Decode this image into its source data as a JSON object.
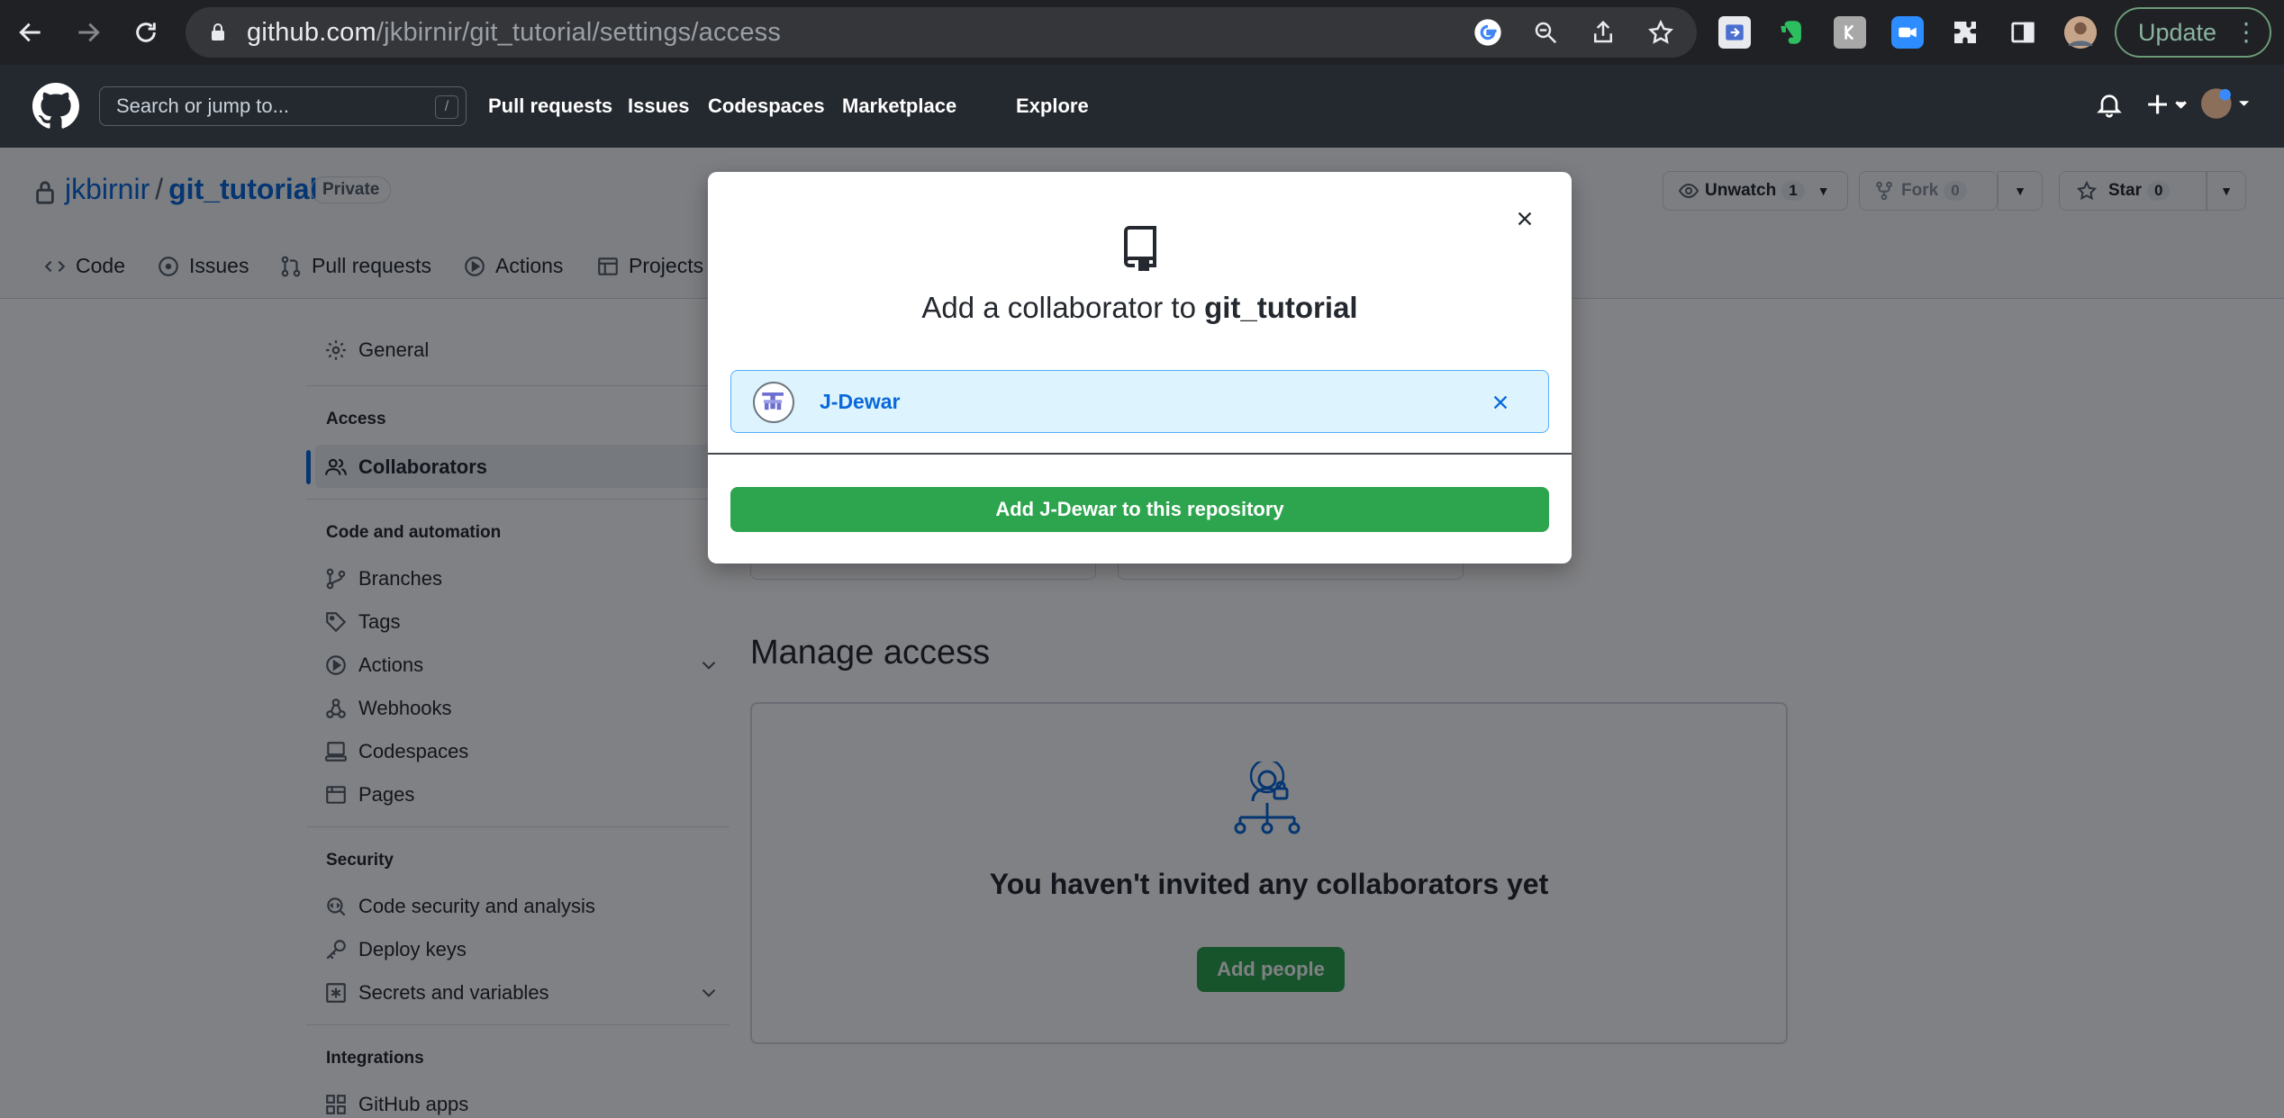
{
  "browser": {
    "url_host": "github.com",
    "url_path": "/jkbirnir/git_tutorial/settings/access",
    "update_label": "Update"
  },
  "gh_header": {
    "search_placeholder": "Search or jump to...",
    "search_shortcut": "/",
    "nav": [
      "Pull requests",
      "Issues",
      "Codespaces",
      "Marketplace",
      "Explore"
    ]
  },
  "repo": {
    "owner": "jkbirnir",
    "separator": "/",
    "name": "git_tutorial",
    "visibility": "Private",
    "unwatch_label": "Unwatch",
    "unwatch_count": "1",
    "fork_label": "Fork",
    "fork_count": "0",
    "star_label": "Star",
    "star_count": "0",
    "tabs": [
      "Code",
      "Issues",
      "Pull requests",
      "Actions",
      "Projects"
    ]
  },
  "sidebar": {
    "general": "General",
    "access_head": "Access",
    "collaborators": "Collaborators",
    "code_head": "Code and automation",
    "branches": "Branches",
    "tags": "Tags",
    "actions": "Actions",
    "webhooks": "Webhooks",
    "codespaces": "Codespaces",
    "pages": "Pages",
    "security_head": "Security",
    "code_security": "Code security and analysis",
    "deploy_keys": "Deploy keys",
    "secrets": "Secrets and variables",
    "integrations_head": "Integrations",
    "github_apps": "GitHub apps"
  },
  "main": {
    "manage_title": "Manage access",
    "empty_message": "You haven't invited any collaborators yet",
    "add_people": "Add people"
  },
  "modal": {
    "title_prefix": "Add a collaborator to ",
    "title_repo": "git_tutorial",
    "selected_user": "J-Dewar",
    "add_button": "Add J-Dewar to this repository"
  },
  "colors": {
    "accent": "#0969da",
    "primary_button": "#2da44e",
    "header_bg": "#24292f"
  }
}
